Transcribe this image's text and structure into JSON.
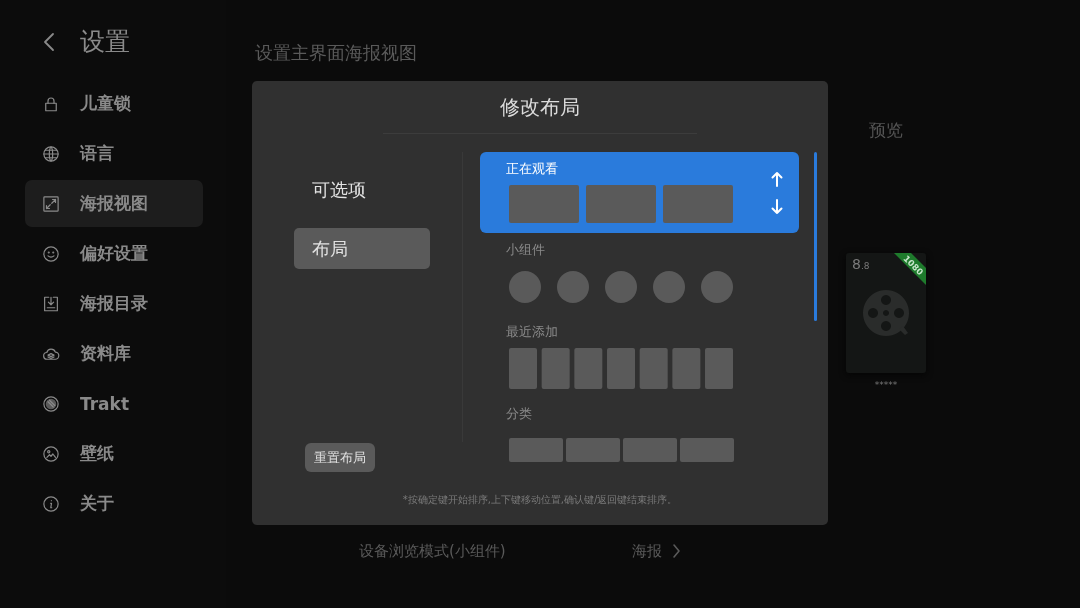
{
  "sidebar": {
    "title": "设置",
    "items": [
      {
        "label": "儿童锁",
        "selected": false
      },
      {
        "label": "语言",
        "selected": false
      },
      {
        "label": "海报视图",
        "selected": true
      },
      {
        "label": "偏好设置",
        "selected": false
      },
      {
        "label": "海报目录",
        "selected": false
      },
      {
        "label": "资料库",
        "selected": false
      },
      {
        "label": "Trakt",
        "selected": false
      },
      {
        "label": "壁纸",
        "selected": false
      },
      {
        "label": "关于",
        "selected": false
      }
    ]
  },
  "main": {
    "heading": "设置主界面海报视图",
    "preview": {
      "label": "预览",
      "poster": {
        "score": "8",
        "score_decimal": ".8",
        "ribbon": "1080",
        "caption": "*****"
      }
    },
    "display_mode": {
      "label": "设备浏览模式(小组件)",
      "value": "海报"
    }
  },
  "dialog": {
    "title": "修改布局",
    "tabs": [
      {
        "label": "可选项",
        "selected": false
      },
      {
        "label": "布局",
        "selected": true
      }
    ],
    "sections": [
      {
        "label": "正在观看",
        "kind": "landscape",
        "selected": true
      },
      {
        "label": "小组件",
        "kind": "circles",
        "selected": false
      },
      {
        "label": "最近添加",
        "kind": "portrait",
        "selected": false
      },
      {
        "label": "分类",
        "kind": "strip",
        "selected": false
      }
    ],
    "reset_button": "重置布局",
    "hint": "*按确定键开始排序,上下键移动位置,确认键/返回键结束排序。"
  }
}
